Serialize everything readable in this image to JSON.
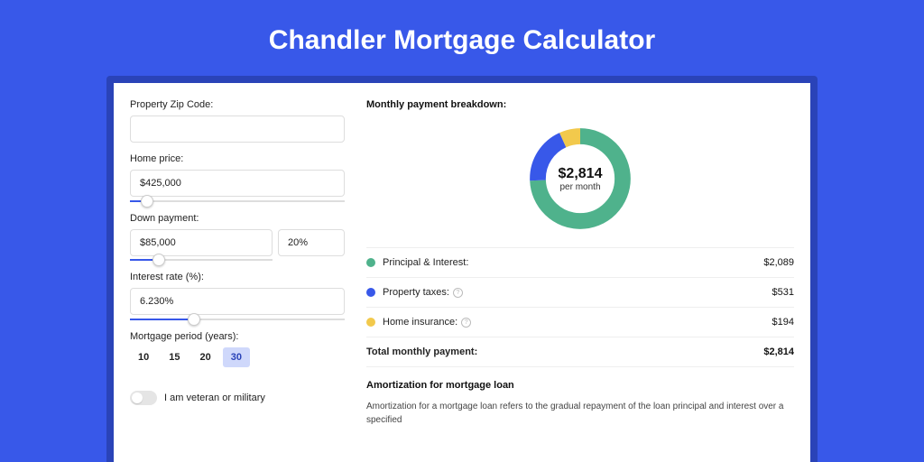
{
  "title": "Chandler Mortgage Calculator",
  "inputs": {
    "zip_label": "Property Zip Code:",
    "zip_value": "",
    "home_price_label": "Home price:",
    "home_price_value": "$425,000",
    "down_payment_label": "Down payment:",
    "down_payment_value": "$85,000",
    "down_payment_pct": "20%",
    "interest_label": "Interest rate (%):",
    "interest_value": "6.230%",
    "period_label": "Mortgage period (years):",
    "periods": [
      "10",
      "15",
      "20",
      "30"
    ],
    "period_active": "30",
    "veteran_label": "I am veteran or military"
  },
  "breakdown": {
    "title": "Monthly payment breakdown:",
    "center_amount": "$2,814",
    "center_sub": "per month",
    "items": [
      {
        "label": "Principal & Interest:",
        "value": "$2,089",
        "color": "#4fb28c",
        "info": false
      },
      {
        "label": "Property taxes:",
        "value": "$531",
        "color": "#3858e9",
        "info": true
      },
      {
        "label": "Home insurance:",
        "value": "$194",
        "color": "#f2c94c",
        "info": true
      }
    ],
    "total_label": "Total monthly payment:",
    "total_value": "$2,814"
  },
  "chart_data": {
    "type": "pie",
    "title": "Monthly payment breakdown",
    "series": [
      {
        "name": "Principal & Interest",
        "value": 2089,
        "color": "#4fb28c"
      },
      {
        "name": "Property taxes",
        "value": 531,
        "color": "#3858e9"
      },
      {
        "name": "Home insurance",
        "value": 194,
        "color": "#f2c94c"
      }
    ],
    "total": 2814,
    "center_label": "$2,814 per month"
  },
  "amortization": {
    "title": "Amortization for mortgage loan",
    "text": "Amortization for a mortgage loan refers to the gradual repayment of the loan principal and interest over a specified"
  },
  "sliders": {
    "home_price_pct": 8,
    "down_payment_pct": 20,
    "interest_pct": 30
  }
}
